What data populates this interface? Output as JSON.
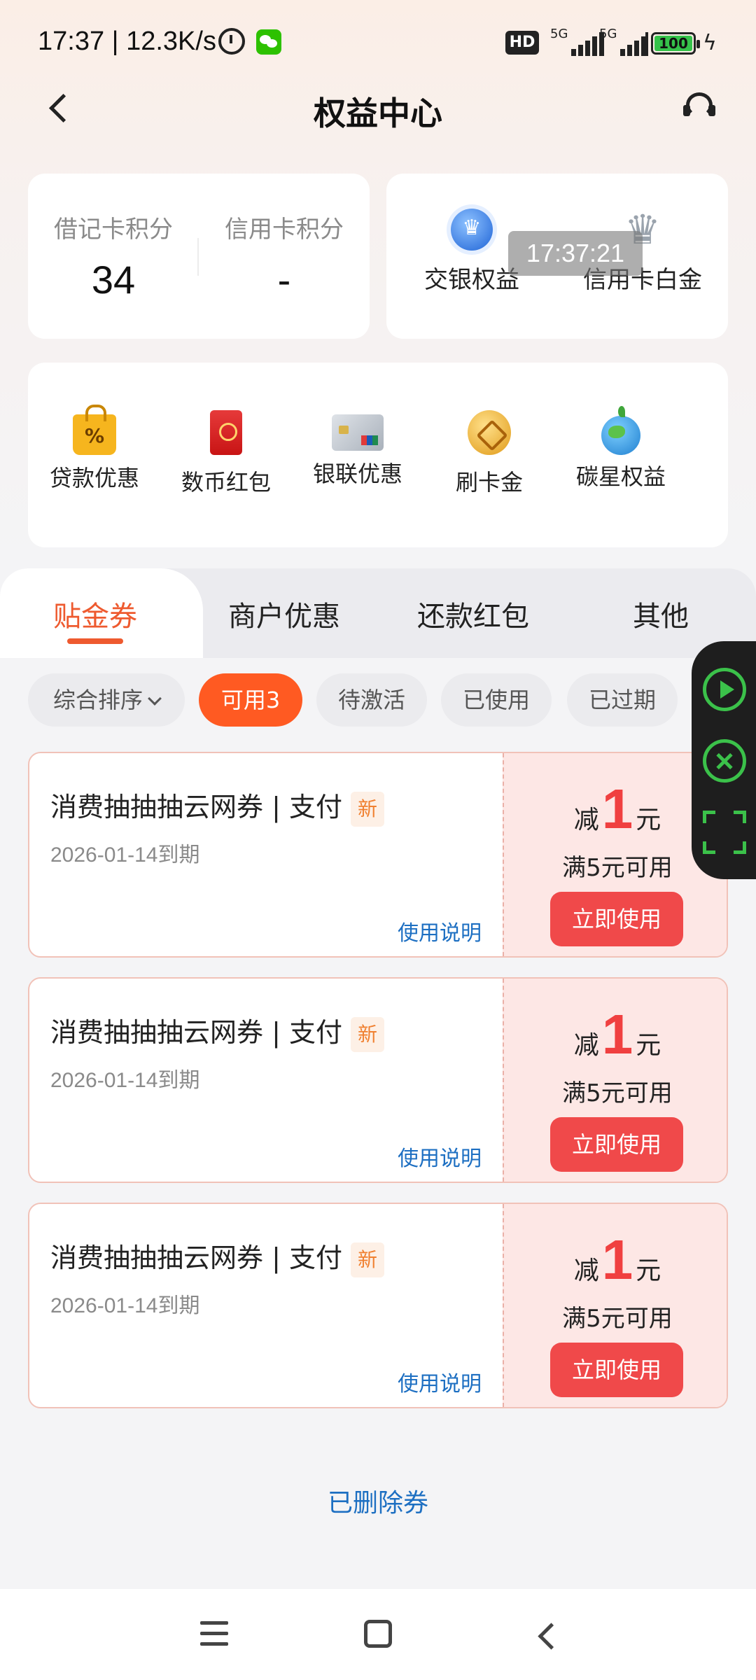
{
  "status_bar": {
    "time_speed": "17:37 | 12.3K/s",
    "hd_label": "HD",
    "signal1_label": "5G",
    "signal2_label": "5G",
    "battery": "100",
    "icons": [
      "alarm-icon",
      "wechat-icon",
      "hd-icon",
      "signal-icon",
      "battery-icon",
      "charging-icon"
    ]
  },
  "header": {
    "title": "权益中心",
    "back_icon": "chevron-left-icon",
    "service_icon": "headset-icon"
  },
  "points": {
    "debit_label": "借记卡积分",
    "debit_value": "34",
    "credit_label": "信用卡积分",
    "credit_value": "-"
  },
  "rights": {
    "items": [
      {
        "label": "交银权益",
        "icon": "crown-badge-icon"
      },
      {
        "label": "信用卡白金",
        "icon": "silver-crown-icon"
      }
    ]
  },
  "toast": {
    "text": "17:37:21"
  },
  "shortcuts": {
    "items": [
      {
        "label": "贷款优惠",
        "icon": "shopping-bag-icon"
      },
      {
        "label": "数币红包",
        "icon": "red-packet-icon"
      },
      {
        "label": "银联优惠",
        "icon": "bank-card-icon"
      },
      {
        "label": "刷卡金",
        "icon": "gold-coin-icon"
      },
      {
        "label": "碳星权益",
        "icon": "globe-icon"
      }
    ]
  },
  "tabs": {
    "items": [
      {
        "label": "贴金券",
        "active": true
      },
      {
        "label": "商户优惠",
        "active": false
      },
      {
        "label": "还款红包",
        "active": false
      },
      {
        "label": "其他",
        "active": false
      }
    ]
  },
  "filters": {
    "sort_label": "综合排序",
    "chips": [
      {
        "label": "可用3",
        "active": true
      },
      {
        "label": "待激活",
        "active": false
      },
      {
        "label": "已使用",
        "active": false
      },
      {
        "label": "已过期",
        "active": false
      }
    ]
  },
  "coupons": [
    {
      "title": "消费抽抽抽云网券 | 支付",
      "badge": "新",
      "expire": "2026-01-14到期",
      "howto": "使用说明",
      "prefix": "减",
      "amount": "1",
      "unit": "元",
      "condition": "满5元可用",
      "action": "立即使用"
    },
    {
      "title": "消费抽抽抽云网券 | 支付",
      "badge": "新",
      "expire": "2026-01-14到期",
      "howto": "使用说明",
      "prefix": "减",
      "amount": "1",
      "unit": "元",
      "condition": "满5元可用",
      "action": "立即使用"
    },
    {
      "title": "消费抽抽抽云网券 | 支付",
      "badge": "新",
      "expire": "2026-01-14到期",
      "howto": "使用说明",
      "prefix": "减",
      "amount": "1",
      "unit": "元",
      "condition": "满5元可用",
      "action": "立即使用"
    }
  ],
  "deleted_link": "已删除券",
  "colors": {
    "accent": "#ee5a2f",
    "chip_active": "#ff5a22",
    "use_button": "#f0494a",
    "link": "#1d6fc2"
  }
}
